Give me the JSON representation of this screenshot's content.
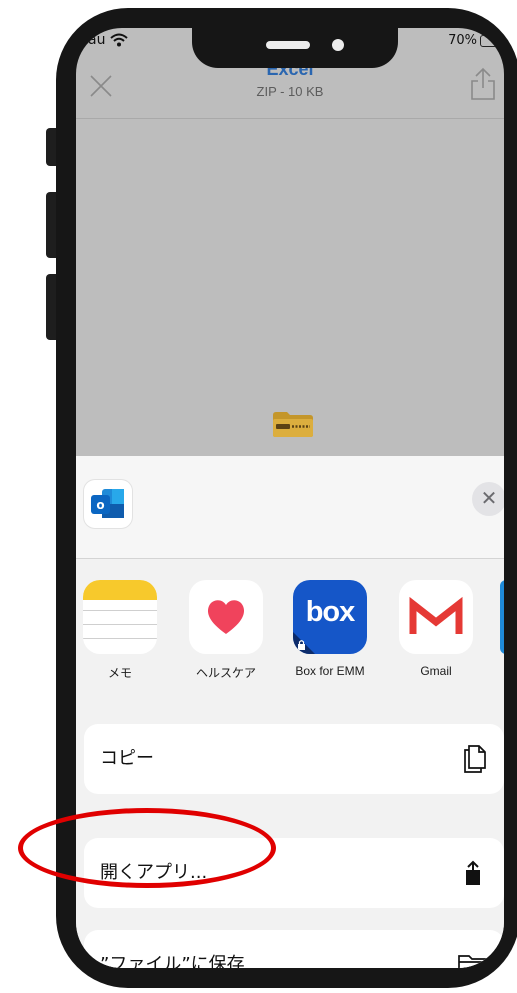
{
  "status_bar": {
    "carrier": "au",
    "battery": "70%"
  },
  "preview": {
    "title": "Excel",
    "subtitle": "ZIP - 10 KB"
  },
  "share_sheet": {
    "apps": [
      {
        "label": "メモ",
        "icon": "notes-icon"
      },
      {
        "label": "ヘルスケア",
        "icon": "health-heart-icon"
      },
      {
        "label": "Box for EMM",
        "icon": "box-icon",
        "icon_text": "box"
      },
      {
        "label": "Gmail",
        "icon": "gmail-icon"
      }
    ],
    "actions": [
      {
        "label": "コピー",
        "icon": "copy-icon"
      },
      {
        "label": "開くアプリ...",
        "icon": "open-in-icon"
      },
      {
        "label": "”ファイル”に保存",
        "icon": "folder-icon"
      }
    ]
  },
  "colors": {
    "title_blue": "#2a66b0",
    "box_blue": "#1556c8",
    "annotation_red": "#e00000"
  }
}
